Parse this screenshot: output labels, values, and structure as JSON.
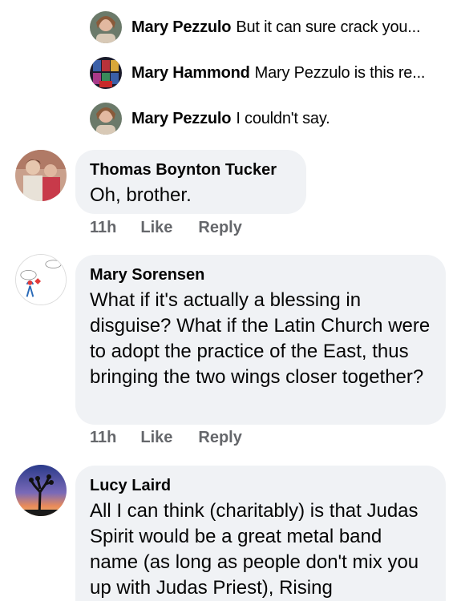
{
  "replies": [
    {
      "name": "Mary Pezzulo",
      "preview": "But it can sure crack you..."
    },
    {
      "name": "Mary Hammond",
      "preview": "Mary Pezzulo is this re..."
    },
    {
      "name": "Mary Pezzulo",
      "preview": "I couldn't say."
    }
  ],
  "comments": [
    {
      "author": "Thomas Boynton Tucker",
      "text": "Oh, brother.",
      "time": "11h",
      "like": "Like",
      "reply": "Reply"
    },
    {
      "author": "Mary Sorensen",
      "text": "What if it's actually a blessing in disguise? What if the Latin Church were to adopt the practice of the East, thus bringing the two wings closer together?",
      "time": "11h",
      "like": "Like",
      "reply": "Reply"
    },
    {
      "author": "Lucy Laird",
      "text": "All I can think (charitably) is that Judas Spirit would be a great metal band name (as long as people don't mix you up with Judas Priest), Rising"
    }
  ],
  "colors": {
    "bubble": "#f0f2f5",
    "meta_text": "#65676b",
    "text": "#050505"
  }
}
